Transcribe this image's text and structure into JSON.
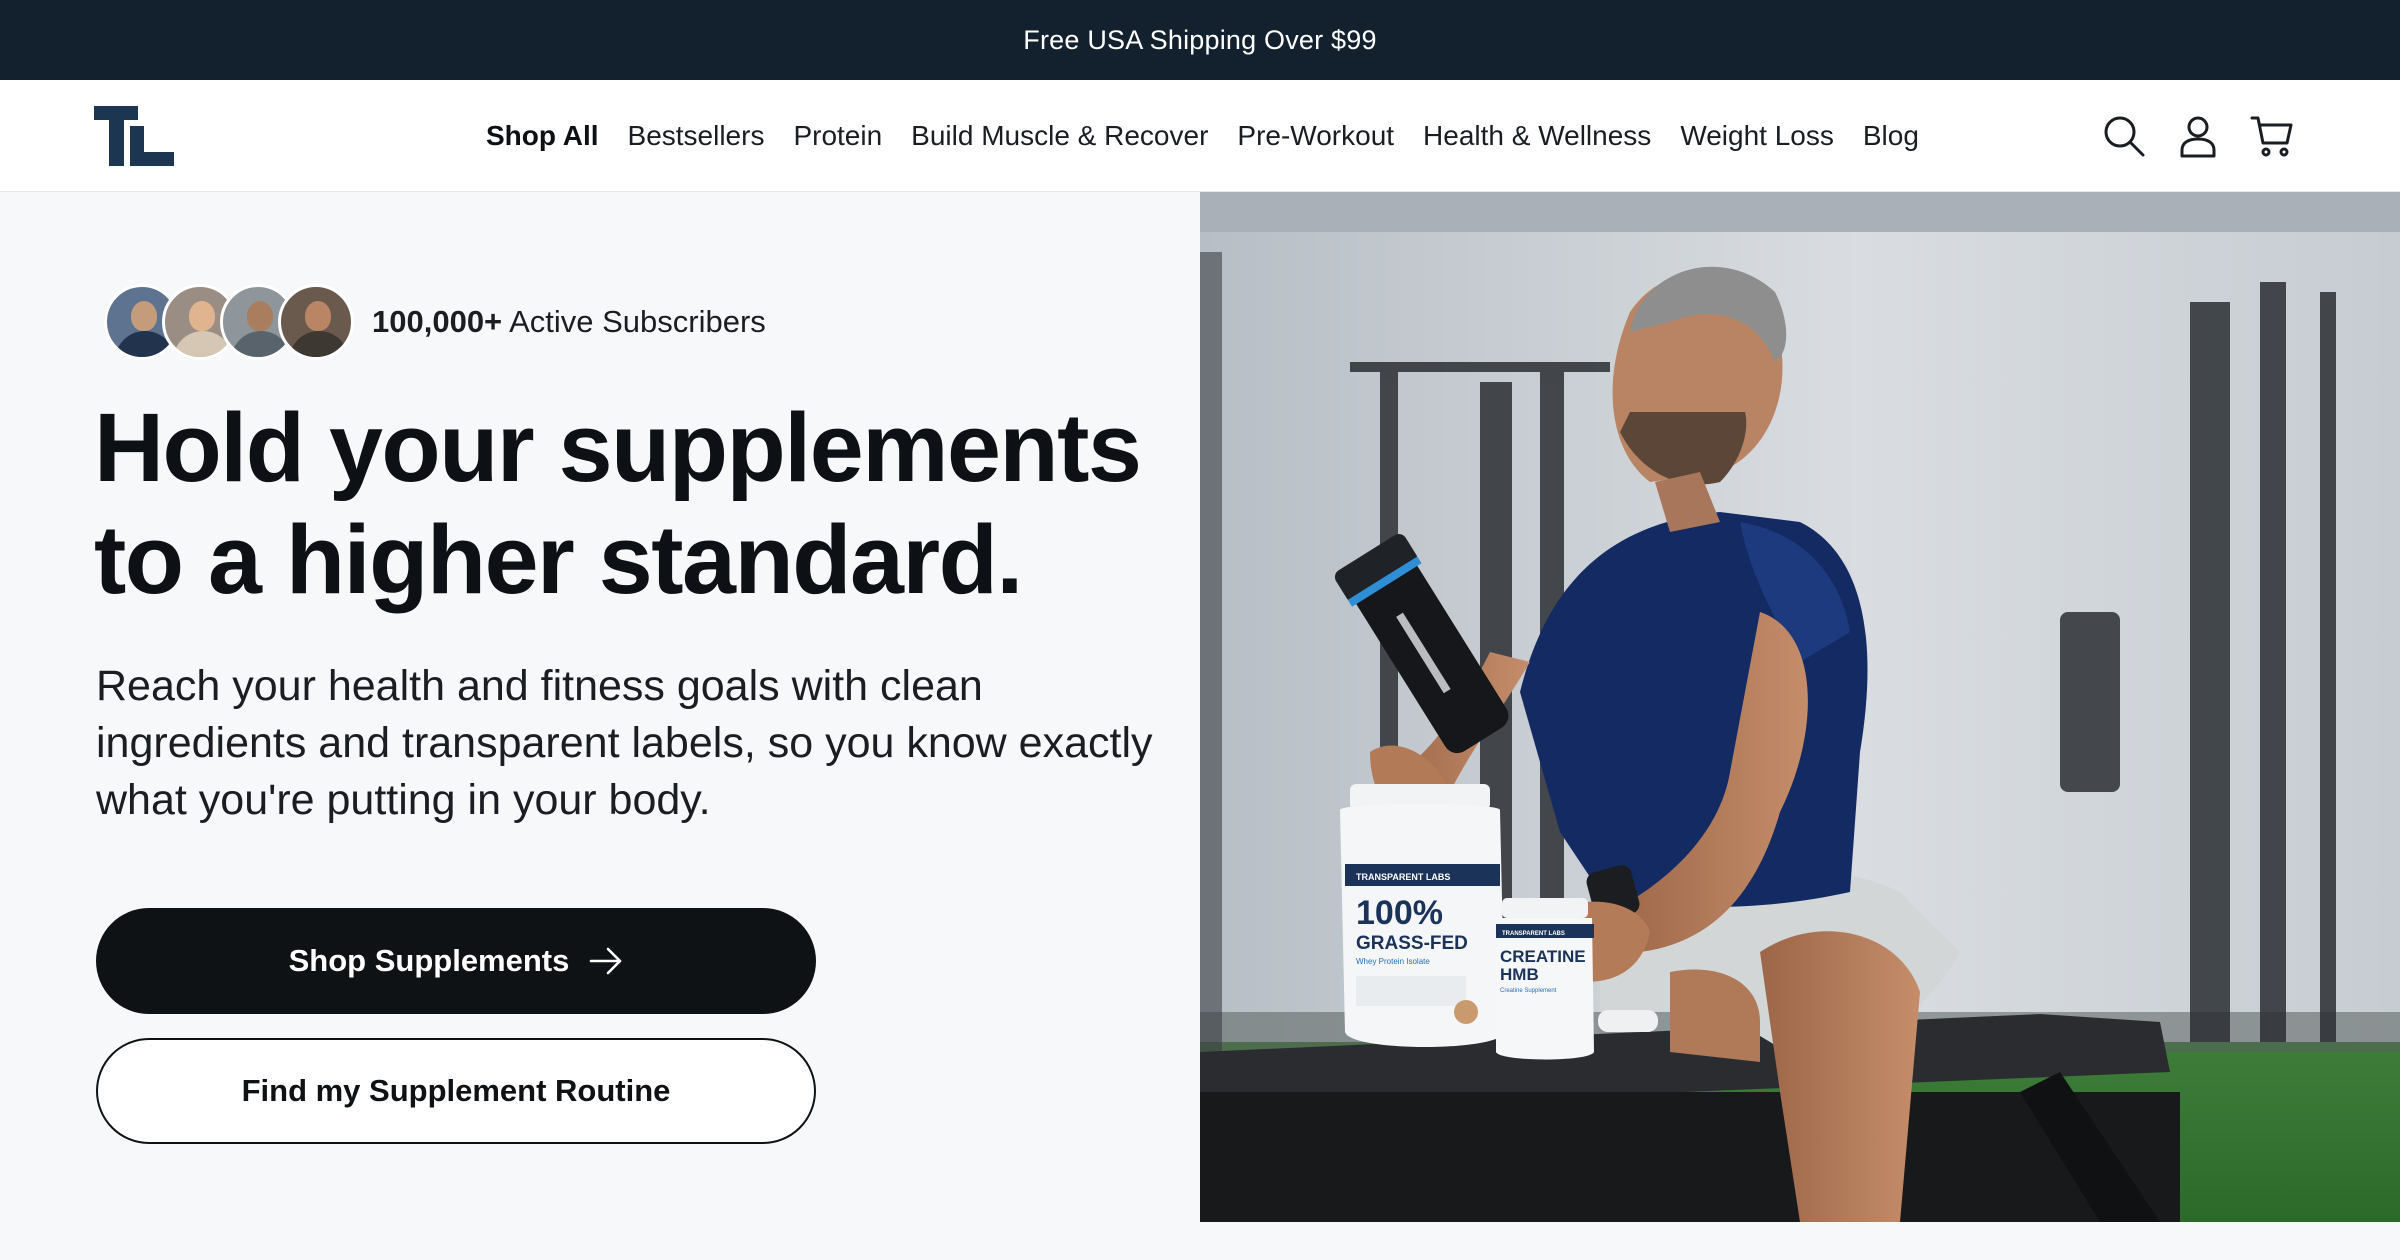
{
  "announcement": {
    "text": "Free USA Shipping Over $99"
  },
  "header": {
    "logo_text": "TL",
    "nav": [
      {
        "label": "Shop All",
        "active": true
      },
      {
        "label": "Bestsellers"
      },
      {
        "label": "Protein"
      },
      {
        "label": "Build Muscle & Recover"
      },
      {
        "label": "Pre-Workout"
      },
      {
        "label": "Health & Wellness"
      },
      {
        "label": "Weight Loss"
      },
      {
        "label": "Blog"
      }
    ],
    "icons": [
      "search-icon",
      "account-icon",
      "cart-icon"
    ]
  },
  "hero": {
    "subscribers": {
      "count": "100,000+",
      "label": "Active Subscribers"
    },
    "headline": "Hold your supplements to a higher standard.",
    "subcopy": "Reach your health and fitness goals with clean ingredients and transparent labels, so you know exactly what you're putting in your body.",
    "primary_button": "Shop Supplements",
    "secondary_button": "Find my Supplement Routine",
    "image": {
      "protein_tub": {
        "brand": "TRANSPARENT LABS",
        "line1": "100%",
        "line2": "GRASS-FED",
        "line3": "Whey Protein Isolate"
      },
      "creatine_tub": {
        "brand": "TRANSPARENT LABS",
        "line1": "CREATINE",
        "line2": "HMB",
        "line3": "Creatine Supplement"
      }
    }
  },
  "colors": {
    "announcement_bg": "#13202e",
    "logo": "#1c3550",
    "primary_button_bg": "#0f1215",
    "page_bg": "#f7f8fa"
  }
}
